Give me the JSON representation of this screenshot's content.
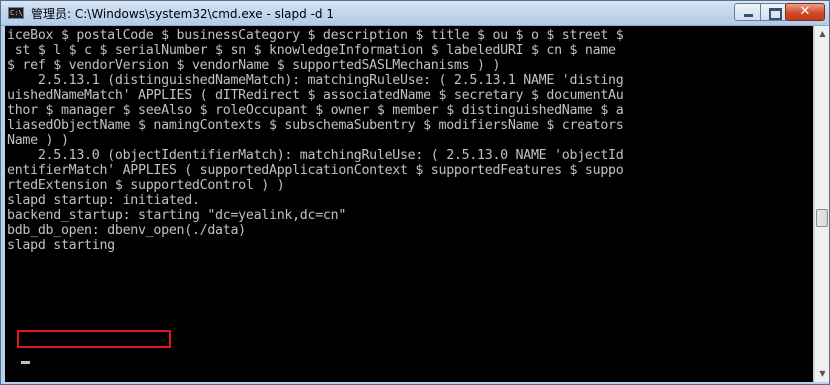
{
  "window": {
    "title": "管理员: C:\\Windows\\system32\\cmd.exe - slapd  -d 1",
    "icon_label": "C:\\",
    "close_glyph": "✕",
    "scroll_up_glyph": "▲",
    "scroll_down_glyph": "▼"
  },
  "console": {
    "lines": [
      "iceBox $ postalCode $ businessCategory $ description $ title $ ou $ o $ street $",
      " st $ l $ c $ serialNumber $ sn $ knowledgeInformation $ labeledURI $ cn $ name",
      "$ ref $ vendorVersion $ vendorName $ supportedSASLMechanisms ) )",
      "    2.5.13.1 (distinguishedNameMatch): matchingRuleUse: ( 2.5.13.1 NAME 'disting",
      "uishedNameMatch' APPLIES ( dITRedirect $ associatedName $ secretary $ documentAu",
      "thor $ manager $ seeAlso $ roleOccupant $ owner $ member $ distinguishedName $ a",
      "liasedObjectName $ namingContexts $ subschemaSubentry $ modifiersName $ creators",
      "Name ) )",
      "    2.5.13.0 (objectIdentifierMatch): matchingRuleUse: ( 2.5.13.0 NAME 'objectId",
      "entifierMatch' APPLIES ( supportedApplicationContext $ supportedFeatures $ suppo",
      "rtedExtension $ supportedControl ) )",
      "slapd startup: initiated.",
      "backend_startup: starting \"dc=yealink,dc=cn\"",
      "bdb_db_open: dbenv_open(./data)",
      "slapd starting",
      ""
    ]
  },
  "colors": {
    "console_bg": "#000000",
    "console_text": "#c0c0c0",
    "highlight_border": "#e0181e"
  }
}
